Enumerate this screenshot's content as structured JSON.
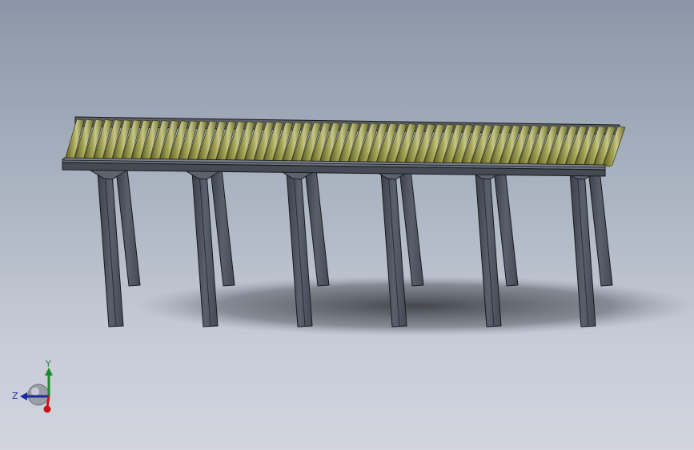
{
  "window": {
    "background_top": "#8b97a8",
    "background_bottom": "#d2d5de"
  },
  "model": {
    "roller_color": "#8a8a3e",
    "roller_highlight": "#c9c98a",
    "frame_color": "#4f5460",
    "frame_edge": "#1a1a1a",
    "leg_pairs": 6
  },
  "triad": {
    "y_label": "Y",
    "z_label": "Z",
    "y_color": "#1e8a2a",
    "z_color": "#1a2b9a",
    "x_color": "#c8151a"
  }
}
